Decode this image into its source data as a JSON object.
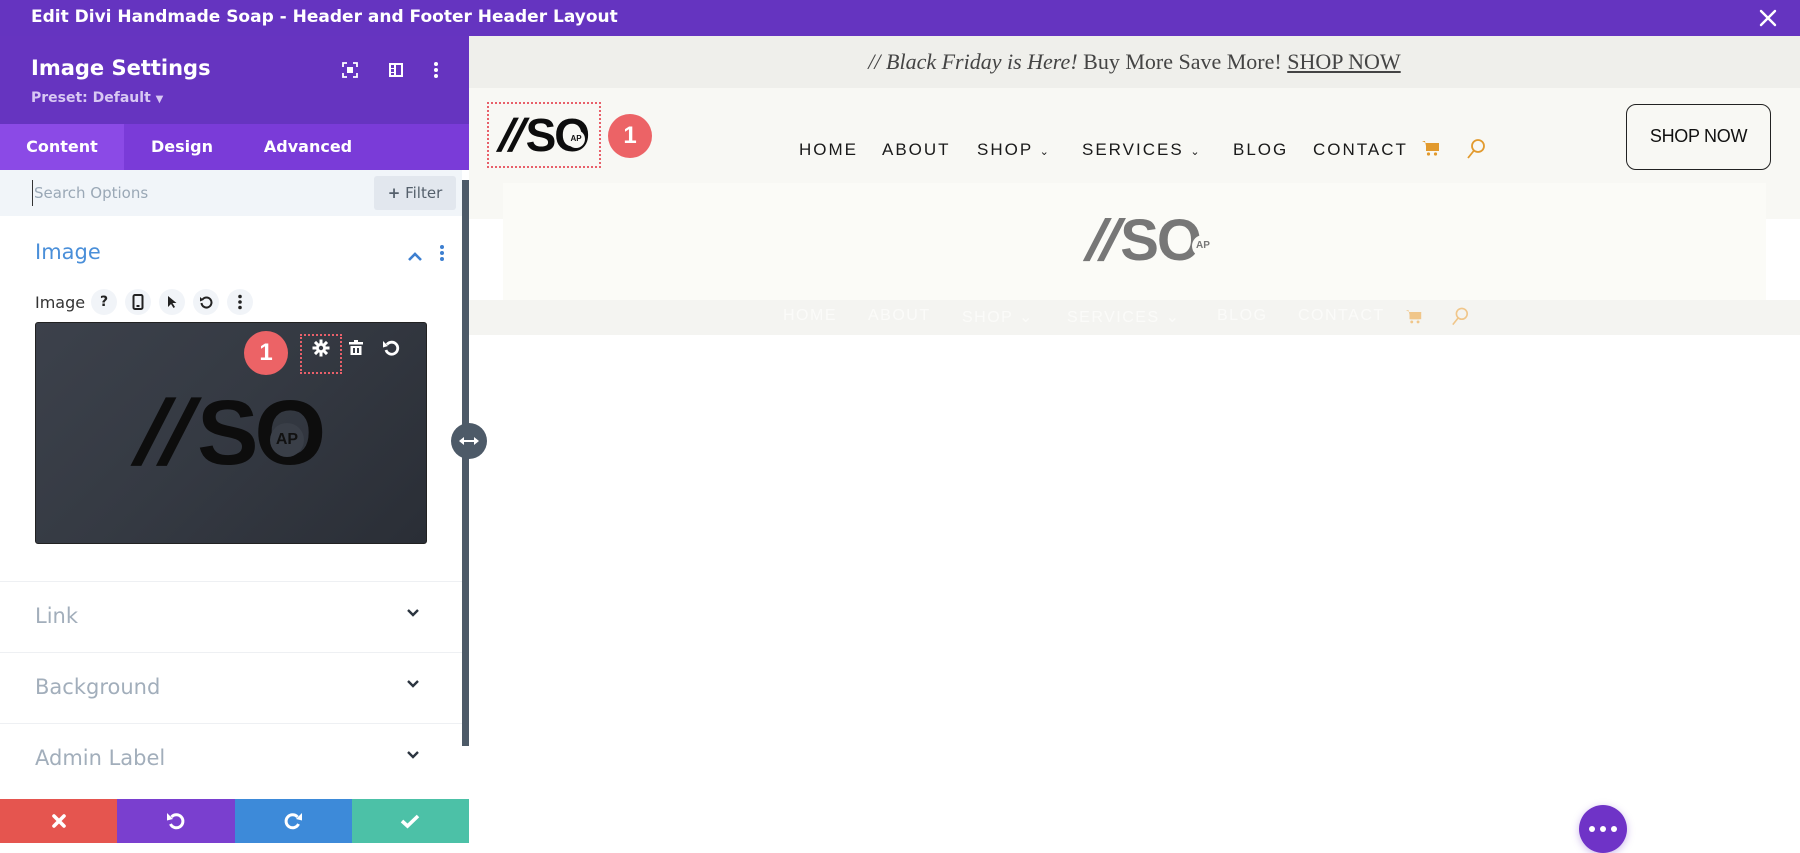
{
  "window": {
    "title": "Edit Divi Handmade Soap - Header and Footer Header Layout",
    "close_icon": "close-icon"
  },
  "panel": {
    "title": "Image Settings",
    "preset": "Preset: Default",
    "header_icons": [
      "fullscreen-icon",
      "split-view-icon",
      "more-vertical-icon"
    ],
    "tabs": [
      {
        "label": "Content",
        "active": true
      },
      {
        "label": "Design",
        "active": false
      },
      {
        "label": "Advanced",
        "active": false
      }
    ],
    "search": {
      "placeholder": "Search Options",
      "value": ""
    },
    "filter_label": "Filter",
    "sections": {
      "image": {
        "title": "Image",
        "expanded": true,
        "field_label": "Image",
        "field_controls": [
          "help-icon",
          "responsive-icon",
          "hover-icon",
          "reset-icon",
          "more-icon"
        ],
        "preview_logo_text": "SO",
        "preview_logo_badge": "AP",
        "preview_tools": [
          "settings-icon",
          "delete-icon",
          "undo-icon"
        ],
        "callout_number": "1"
      },
      "collapsed": [
        {
          "label": "Link"
        },
        {
          "label": "Background"
        },
        {
          "label": "Admin Label"
        }
      ]
    },
    "footer_actions": [
      {
        "name": "discard",
        "icon": "close-icon",
        "color": "#e5554f"
      },
      {
        "name": "undo",
        "icon": "undo-icon",
        "color": "#7a3fcf"
      },
      {
        "name": "redo",
        "icon": "redo-icon",
        "color": "#3d8ad9"
      },
      {
        "name": "save",
        "icon": "check-icon",
        "color": "#4cc1a7"
      }
    ]
  },
  "preview": {
    "promo": {
      "italic_text": "// Black Friday is Here!",
      "text": " Buy More Save More! ",
      "link": "SHOP NOW"
    },
    "logo_text": "SO",
    "logo_badge": "AP",
    "callout_number": "1",
    "nav": [
      {
        "label": "HOME",
        "dropdown": false
      },
      {
        "label": "ABOUT",
        "dropdown": false
      },
      {
        "label": "SHOP",
        "dropdown": true
      },
      {
        "label": "SERVICES",
        "dropdown": true
      },
      {
        "label": "BLOG",
        "dropdown": false
      },
      {
        "label": "CONTACT",
        "dropdown": false
      }
    ],
    "cta_label": "SHOP NOW",
    "accent_color": "#e29a2d"
  },
  "colors": {
    "brand_purple": "#6534c0",
    "tab_bar": "#7a3bd8",
    "section_title_blue": "#4a8fd9",
    "callout_red": "#ec6366"
  }
}
